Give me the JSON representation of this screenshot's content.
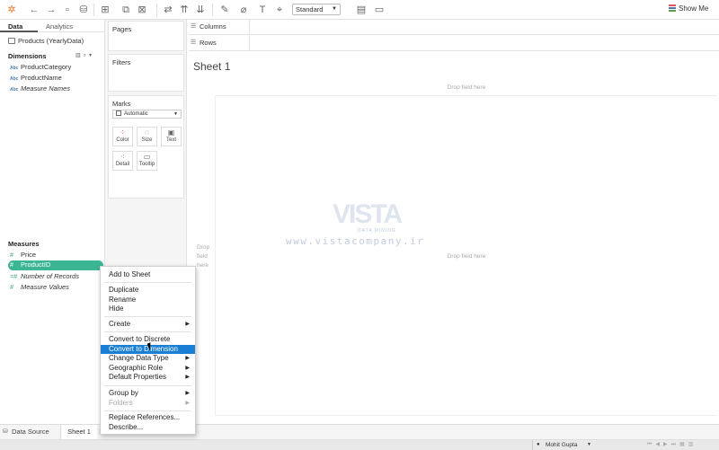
{
  "toolbar": {
    "standard_label": "Standard",
    "show_me_label": "Show Me"
  },
  "data_pane": {
    "tabs": [
      "Data",
      "Analytics"
    ],
    "datasource": "Products (YearlyData)",
    "dimensions_title": "Dimensions",
    "dimensions": [
      {
        "type": "Abc",
        "label": "ProductCategory"
      },
      {
        "type": "Abc",
        "label": "ProductName"
      },
      {
        "type": "Abc",
        "label": "Measure Names"
      }
    ],
    "measures_title": "Measures",
    "measures": [
      {
        "type": "#",
        "label": "Price"
      },
      {
        "type": "#",
        "label": "ProductID"
      },
      {
        "type": "=#",
        "label": "Number of Records"
      },
      {
        "type": "#",
        "label": "Measure Values"
      }
    ]
  },
  "cards": {
    "pages": "Pages",
    "filters": "Filters",
    "marks": "Marks",
    "marks_type": "Automatic",
    "mark_buttons": [
      "Color",
      "Size",
      "Text",
      "Detail",
      "Tooltip"
    ]
  },
  "shelves": {
    "columns": "Columns",
    "rows": "Rows"
  },
  "sheet": {
    "title": "Sheet 1",
    "drop_hint": "Drop field here",
    "drop_left": "Drop field here"
  },
  "watermark": {
    "logo": "VISTA",
    "sub": "DATA MINING",
    "url": "www.vistacompany.ir"
  },
  "bottom": {
    "datasource_tab": "Data Source",
    "sheet_tab": "Sheet 1",
    "user": "Mohit Gupta"
  },
  "context_menu": {
    "items": [
      "Add to Sheet",
      "Duplicate",
      "Rename",
      "Hide",
      "Create",
      "Convert to Discrete",
      "Convert to Dimension",
      "Change Data Type",
      "Geographic Role",
      "Default Properties",
      "Group by",
      "Folders",
      "Replace References...",
      "Describe..."
    ],
    "highlighted": "Convert to Dimension"
  }
}
